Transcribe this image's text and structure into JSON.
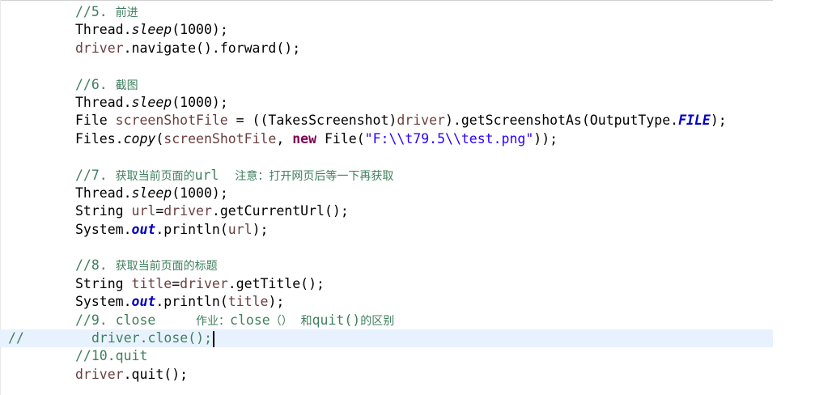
{
  "editor": {
    "language": "Java",
    "lines": [
      {
        "id": "comment-5",
        "segments": [
          {
            "t": "//5. ",
            "c": "cm"
          },
          {
            "t": "前进",
            "c": "cm-cjk"
          }
        ]
      },
      {
        "id": "thread-sleep-1",
        "segments": [
          {
            "t": "Thread."
          },
          {
            "t": "sleep",
            "c": "sm"
          },
          {
            "t": "(1000);"
          }
        ]
      },
      {
        "id": "navigate-forward",
        "segments": [
          {
            "t": "driver",
            "c": "fld"
          },
          {
            "t": ".navigate().forward();"
          }
        ]
      },
      {
        "id": "blank-1",
        "segments": []
      },
      {
        "id": "comment-6",
        "segments": [
          {
            "t": "//6. ",
            "c": "cm"
          },
          {
            "t": "截图",
            "c": "cm-cjk"
          }
        ]
      },
      {
        "id": "thread-sleep-2",
        "segments": [
          {
            "t": "Thread."
          },
          {
            "t": "sleep",
            "c": "sm"
          },
          {
            "t": "(1000);"
          }
        ]
      },
      {
        "id": "screenshot-file",
        "segments": [
          {
            "t": "File "
          },
          {
            "t": "screenShotFile",
            "c": "fld"
          },
          {
            "t": " = ((TakesScreenshot)"
          },
          {
            "t": "driver",
            "c": "fld"
          },
          {
            "t": ").getScreenshotAs(OutputType."
          },
          {
            "t": "FILE",
            "c": "sf"
          },
          {
            "t": ");"
          }
        ]
      },
      {
        "id": "files-copy",
        "segments": [
          {
            "t": "Files."
          },
          {
            "t": "copy",
            "c": "sm"
          },
          {
            "t": "("
          },
          {
            "t": "screenShotFile",
            "c": "fld"
          },
          {
            "t": ", "
          },
          {
            "t": "new",
            "c": "kw"
          },
          {
            "t": " File("
          },
          {
            "t": "\"F:\\\\t79.5\\\\test.png\"",
            "c": "str"
          },
          {
            "t": "));"
          }
        ]
      },
      {
        "id": "blank-2",
        "segments": []
      },
      {
        "id": "comment-7",
        "segments": [
          {
            "t": "//7. ",
            "c": "cm"
          },
          {
            "t": "获取当前页面的",
            "c": "cm-cjk"
          },
          {
            "t": "url  ",
            "c": "cm"
          },
          {
            "t": "注意：打开网页后等一下再获取",
            "c": "cm-cjk"
          }
        ]
      },
      {
        "id": "thread-sleep-3",
        "segments": [
          {
            "t": "Thread."
          },
          {
            "t": "sleep",
            "c": "sm"
          },
          {
            "t": "(1000);"
          }
        ]
      },
      {
        "id": "get-current-url",
        "segments": [
          {
            "t": "String "
          },
          {
            "t": "url",
            "c": "fld"
          },
          {
            "t": "="
          },
          {
            "t": "driver",
            "c": "fld"
          },
          {
            "t": ".getCurrentUrl();"
          }
        ]
      },
      {
        "id": "print-url",
        "segments": [
          {
            "t": "System."
          },
          {
            "t": "out",
            "c": "sf"
          },
          {
            "t": ".println("
          },
          {
            "t": "url",
            "c": "fld"
          },
          {
            "t": ");"
          }
        ]
      },
      {
        "id": "blank-3",
        "segments": []
      },
      {
        "id": "comment-8",
        "segments": [
          {
            "t": "//8. ",
            "c": "cm"
          },
          {
            "t": "获取当前页面的标题",
            "c": "cm-cjk"
          }
        ]
      },
      {
        "id": "get-title",
        "segments": [
          {
            "t": "String "
          },
          {
            "t": "title",
            "c": "fld"
          },
          {
            "t": "="
          },
          {
            "t": "driver",
            "c": "fld"
          },
          {
            "t": ".getTitle();"
          }
        ]
      },
      {
        "id": "print-title",
        "segments": [
          {
            "t": "System."
          },
          {
            "t": "out",
            "c": "sf"
          },
          {
            "t": ".println("
          },
          {
            "t": "title",
            "c": "fld"
          },
          {
            "t": ");"
          }
        ]
      },
      {
        "id": "comment-9",
        "segments": [
          {
            "t": "//9. close     ",
            "c": "cm"
          },
          {
            "t": "作业：",
            "c": "cm-cjk"
          },
          {
            "t": "close",
            "c": "cm"
          },
          {
            "t": "（）",
            "c": "cm-cjk"
          },
          {
            "t": " ",
            "c": "cm"
          },
          {
            "t": "和",
            "c": "cm-cjk"
          },
          {
            "t": "quit()",
            "c": "cm"
          },
          {
            "t": "的区别",
            "c": "cm-cjk"
          }
        ]
      },
      {
        "id": "driver-close-commented",
        "gutter": "//",
        "indent": true,
        "current": true,
        "caret": true,
        "segments": [
          {
            "t": "driver.close();",
            "c": "cm"
          }
        ]
      },
      {
        "id": "comment-10",
        "segments": [
          {
            "t": "//10.quit",
            "c": "cm"
          }
        ]
      },
      {
        "id": "driver-quit",
        "segments": [
          {
            "t": "driver",
            "c": "fld"
          },
          {
            "t": ".quit();"
          }
        ]
      }
    ]
  }
}
